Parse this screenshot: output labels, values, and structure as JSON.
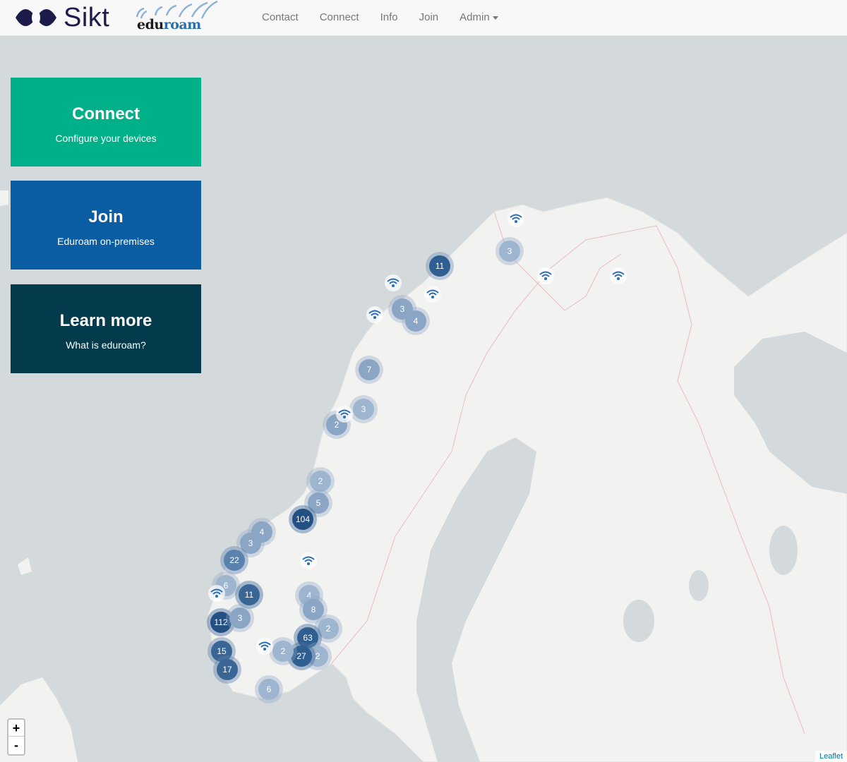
{
  "brand": {
    "sikt": "Sikt",
    "eduroam_edu": "edu",
    "eduroam_roam": "roam"
  },
  "nav": {
    "contact": "Contact",
    "connect": "Connect",
    "info": "Info",
    "join": "Join",
    "admin": "Admin"
  },
  "cards": {
    "connect": {
      "title": "Connect",
      "subtitle": "Configure your devices",
      "color": "#00b088"
    },
    "join": {
      "title": "Join",
      "subtitle": "Eduroam on-premises",
      "color": "#0a5da3"
    },
    "learn": {
      "title": "Learn more",
      "subtitle": "What is eduroam?",
      "color": "#043b4c"
    }
  },
  "map": {
    "zoom_in": "+",
    "zoom_out": "-",
    "attribution": "Leaflet",
    "clusters": [
      "11",
      "3",
      "3",
      "4",
      "7",
      "3",
      "2",
      "2",
      "5",
      "104",
      "4",
      "3",
      "22",
      "6",
      "11",
      "112",
      "3",
      "4",
      "8",
      "2",
      "63",
      "27",
      "2",
      "2",
      "15",
      "17",
      "6"
    ]
  },
  "colors": {
    "sea": "#d4dadc",
    "land": "#f2f2f1",
    "marker_dark": "#2f5f90",
    "marker_light": "#8aa6c4"
  }
}
